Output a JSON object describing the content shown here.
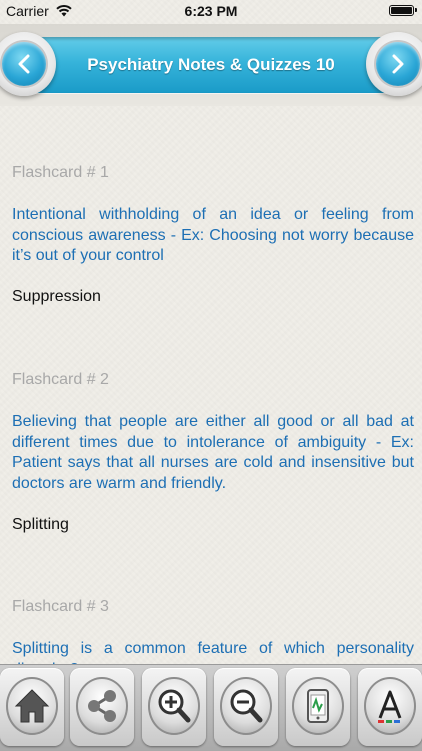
{
  "status_bar": {
    "carrier": "Carrier",
    "time": "6:23 PM"
  },
  "header": {
    "title": "Psychiatry Notes & Quizzes 10"
  },
  "flashcards": [
    {
      "number": "Flashcard # 1",
      "question": "Intentional withholding of an idea or feeling from conscious awareness - Ex: Choosing not worry because it’s out of your control",
      "answer": "Suppression"
    },
    {
      "number": "Flashcard # 2",
      "question": "Believing that people are either all good or all bad at different times due to intolerance of ambiguity - Ex: Patient says that all nurses are cold and insensitive but doctors are warm and friendly.",
      "answer": "Splitting"
    },
    {
      "number": "Flashcard # 3",
      "question": "Splitting is a common feature of which personality disorder?",
      "answer": ""
    }
  ],
  "toolbar": {
    "icons": [
      "home-icon",
      "share-icon",
      "zoom-in-icon",
      "zoom-out-icon",
      "quiz-icon",
      "font-icon"
    ]
  },
  "colors": {
    "accent": "#36b3da",
    "question_text": "#1d6fb4",
    "number_text": "#a8a8a8"
  }
}
